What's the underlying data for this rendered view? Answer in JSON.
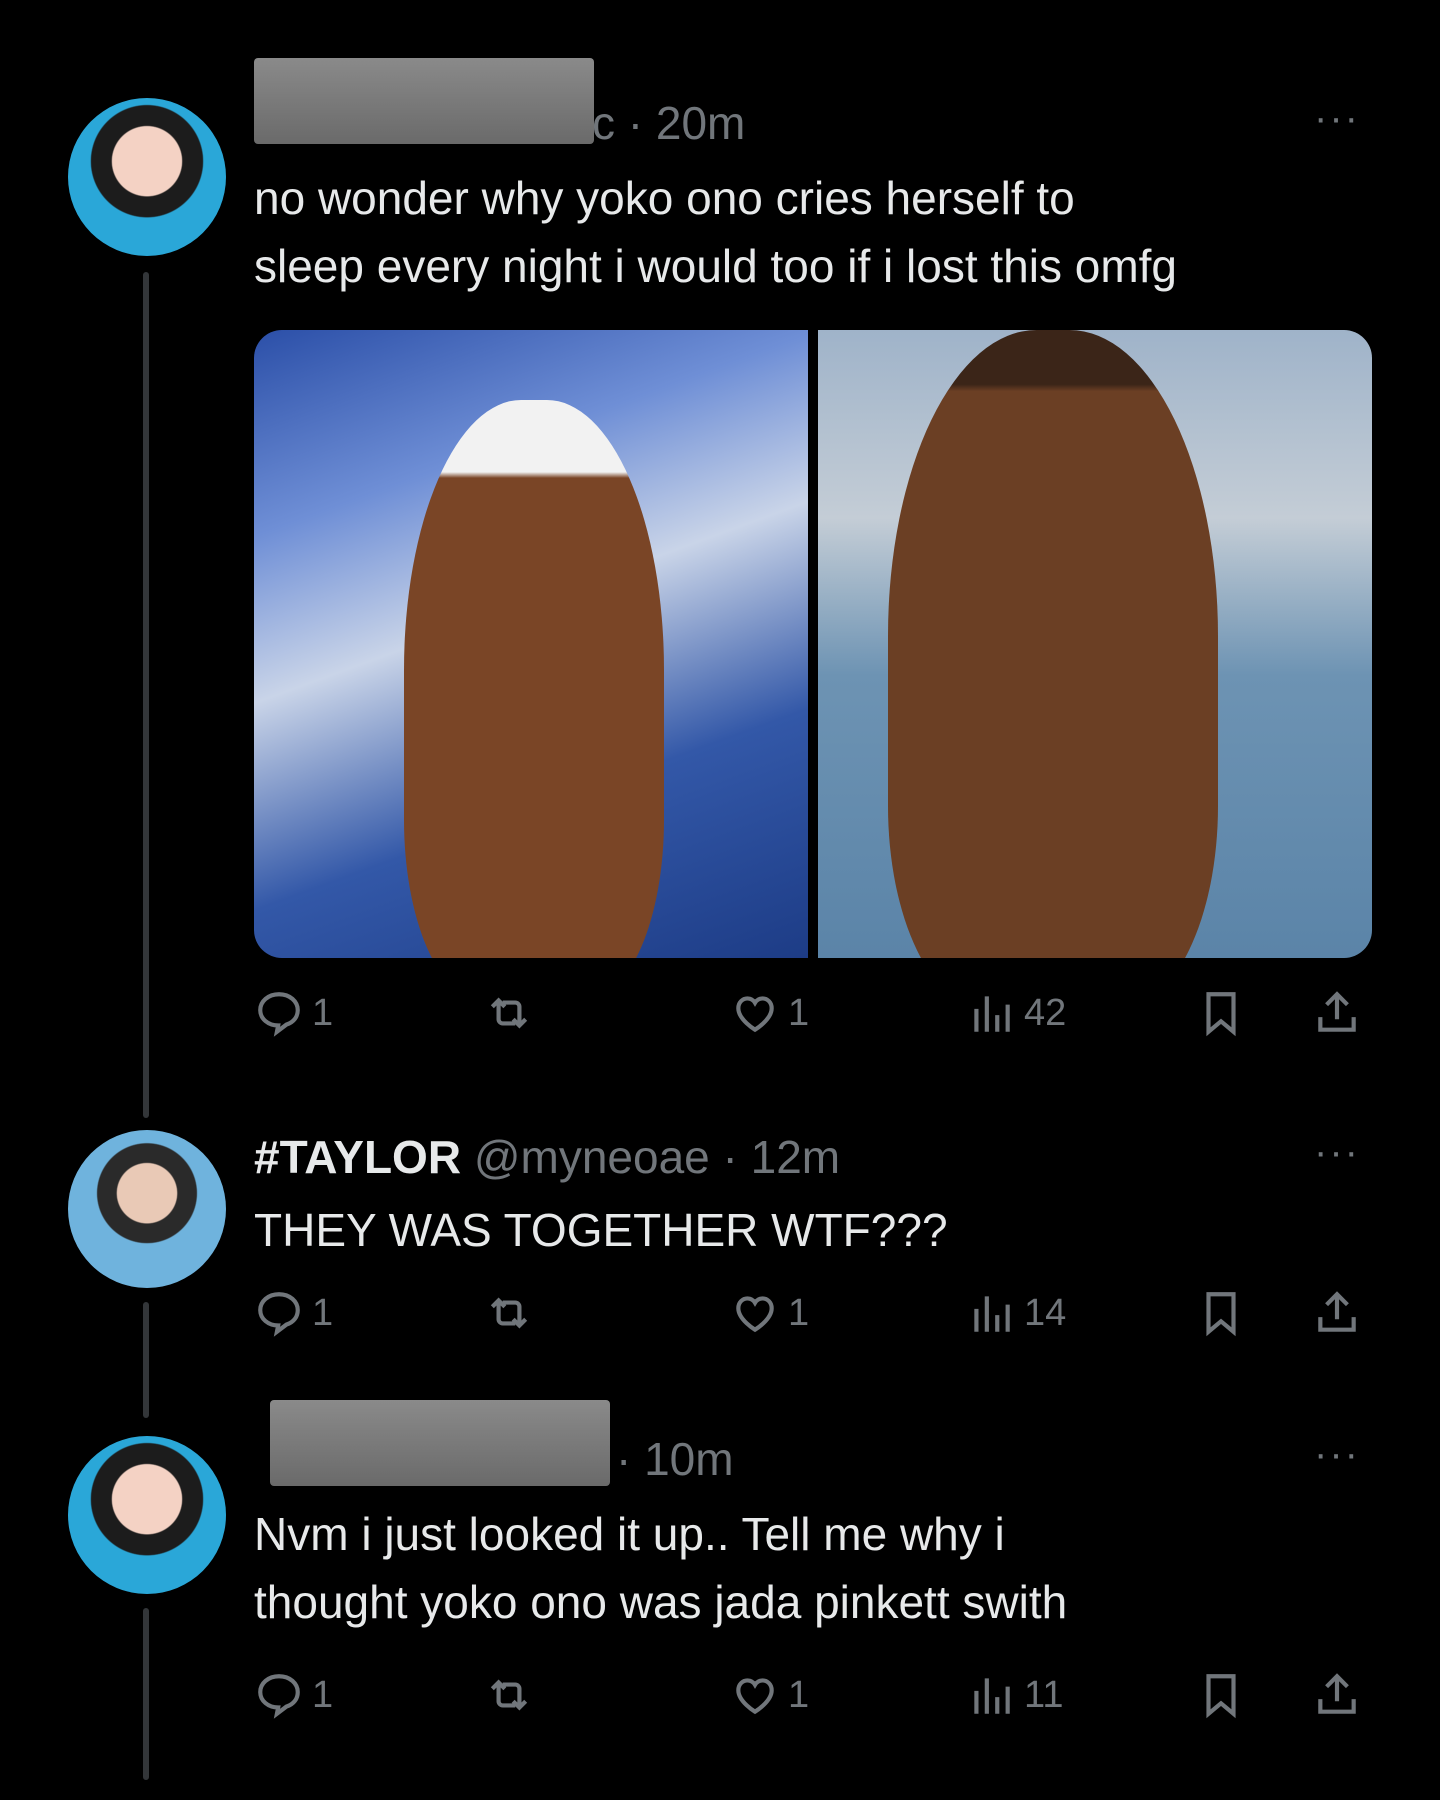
{
  "tweets": [
    {
      "time_suffix": "c · 20m",
      "text_line1": "no wonder why yoko ono cries herself to",
      "text_line2": "sleep every night i would too if i lost this omfg",
      "more": "···",
      "stats": {
        "replies": "1",
        "likes": "1",
        "views": "42"
      }
    },
    {
      "display_name": "#TAYLOR",
      "handle": "@myneoae",
      "time": "· 12m",
      "text": "THEY WAS TOGETHER WTF???",
      "more": "···",
      "stats": {
        "replies": "1",
        "likes": "1",
        "views": "14"
      }
    },
    {
      "time_suffix": "· 10m",
      "text_line1": "Nvm i just looked it up.. Tell me why i",
      "text_line2": "thought yoko ono was jada pinkett swith",
      "more": "···",
      "stats": {
        "replies": "1",
        "likes": "1",
        "views": "11"
      }
    }
  ],
  "icons": [
    "reply-icon",
    "retweet-icon",
    "like-icon",
    "views-icon",
    "bookmark-icon",
    "share-icon"
  ],
  "colors": {
    "background": "#000000",
    "text": "#e7e9ea",
    "muted": "#71767b"
  }
}
